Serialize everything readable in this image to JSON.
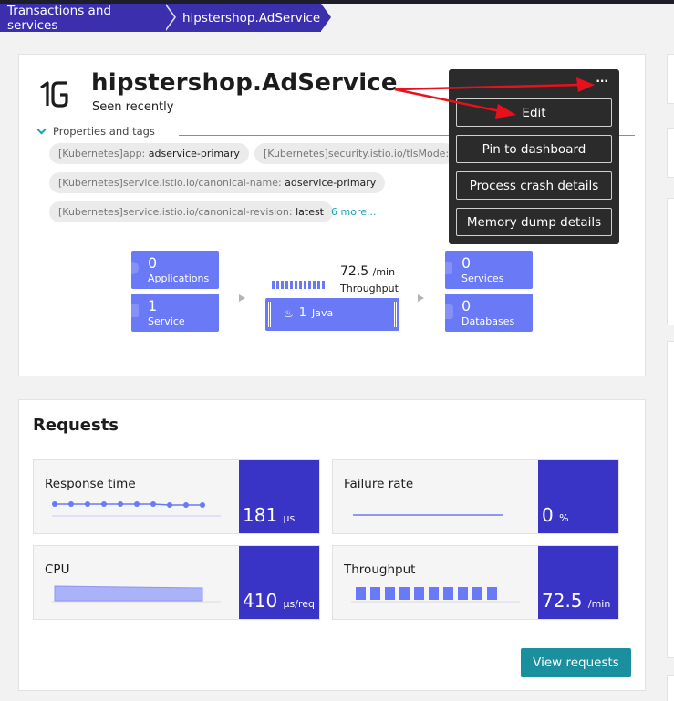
{
  "breadcrumb": {
    "items": [
      "Transactions and services",
      "hipstershop.AdService"
    ]
  },
  "service": {
    "name": "hipstershop.AdService",
    "status": "Seen recently",
    "props_label": "Properties and tags",
    "tags": [
      {
        "key": "[Kubernetes]app:",
        "value": "adservice-primary"
      },
      {
        "key": "[Kubernetes]security.istio.io/tlsMode:",
        "value": ""
      },
      {
        "key": "[Kubernetes]service.istio.io/canonical-name:",
        "value": "adservice-primary"
      },
      {
        "key": "[Kubernetes]service.istio.io/canonical-revision:",
        "value": "latest"
      }
    ],
    "more_tags": "6 more..."
  },
  "topology": {
    "applications": {
      "count": "0",
      "label": "Applications"
    },
    "service": {
      "count": "1",
      "label": "Service"
    },
    "process": {
      "count": "1",
      "label": "Java"
    },
    "throughput": {
      "value": "72.5",
      "unit": "/min",
      "label": "Throughput"
    },
    "services": {
      "count": "0",
      "label": "Services"
    },
    "databases": {
      "count": "0",
      "label": "Databases"
    }
  },
  "menu": {
    "dots": "···",
    "items": [
      "Edit",
      "Pin to dashboard",
      "Process crash details",
      "Memory dump details"
    ]
  },
  "requests": {
    "title": "Requests",
    "tiles": [
      {
        "label": "Response time",
        "value": "181",
        "unit": "µs"
      },
      {
        "label": "Failure rate",
        "value": "0",
        "unit": "%"
      },
      {
        "label": "CPU",
        "value": "410",
        "unit": "µs/req"
      },
      {
        "label": "Throughput",
        "value": "72.5",
        "unit": "/min"
      }
    ],
    "view_button": "View requests"
  },
  "colors": {
    "breadcrumb": "#3b2fae",
    "tile_blue": "#6a79f6",
    "metric_value_bg": "#3a34c6",
    "accent_teal": "#1aa3b8",
    "button_teal": "#1a8f9e",
    "menu_bg": "#2b2b2b",
    "annotation_red": "#e8101a"
  }
}
